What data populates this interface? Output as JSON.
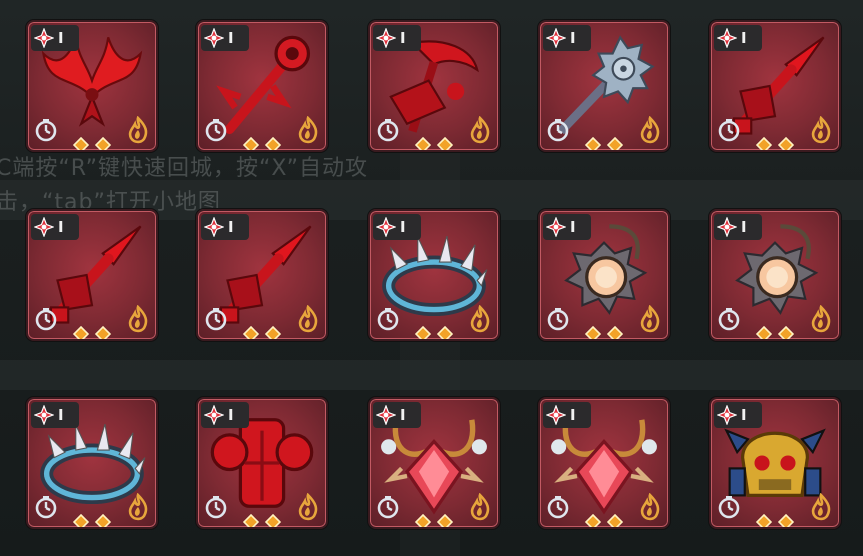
{
  "background": {
    "line1": "C端按“R”键快速回城，按“X”自动攻",
    "line2": "击，“tab”打开小地图"
  },
  "items": [
    {
      "name": "Crimson Wings",
      "tier": "I",
      "icon": "red-wings-icon"
    },
    {
      "name": "Crimson Eye Staff",
      "tier": "I",
      "icon": "red-eye-staff-icon"
    },
    {
      "name": "Crimson Scythe",
      "tier": "I",
      "icon": "red-scythe-icon"
    },
    {
      "name": "Spiked Mace",
      "tier": "I",
      "icon": "silver-mace-icon"
    },
    {
      "name": "Crimson Spear",
      "tier": "I",
      "icon": "red-spear-icon"
    },
    {
      "name": "Crimson Spear",
      "tier": "I",
      "icon": "red-spear-icon"
    },
    {
      "name": "Crimson Spear",
      "tier": "I",
      "icon": "red-spear-icon"
    },
    {
      "name": "Spiked Frost Ring",
      "tier": "I",
      "icon": "spiked-ring-icon"
    },
    {
      "name": "Spiked Orb Amulet",
      "tier": "I",
      "icon": "spiked-amulet-icon"
    },
    {
      "name": "Spiked Orb Amulet",
      "tier": "I",
      "icon": "spiked-amulet-icon"
    },
    {
      "name": "Spiked Frost Ring",
      "tier": "I",
      "icon": "spiked-ring-icon"
    },
    {
      "name": "Crimson Armor",
      "tier": "I",
      "icon": "red-armor-icon"
    },
    {
      "name": "Ruby Necklace",
      "tier": "I",
      "icon": "ruby-necklace-icon"
    },
    {
      "name": "Ruby Necklace",
      "tier": "I",
      "icon": "ruby-necklace-icon"
    },
    {
      "name": "Golden Skull Helm",
      "tier": "I",
      "icon": "skull-helm-icon"
    }
  ],
  "colors": {
    "card": "#7e2a33",
    "badge": "#2b2a2c",
    "star": "#e0313c",
    "gem": "#f2a228"
  }
}
